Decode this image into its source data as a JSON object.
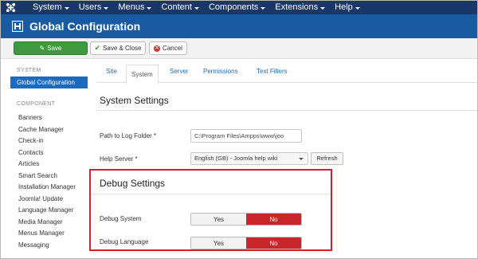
{
  "topnav": {
    "logo_icon": "joomla-logo-icon",
    "menus": [
      "System",
      "Users",
      "Menus",
      "Content",
      "Components",
      "Extensions",
      "Help"
    ]
  },
  "titlebar": {
    "icon": "gear-grid-icon",
    "title": "Global Configuration"
  },
  "toolbar": {
    "save_label": "Save",
    "save_close_label": "Save & Close",
    "cancel_label": "Cancel"
  },
  "sidebar": {
    "system_heading": "SYSTEM",
    "active_item": "Global Configuration",
    "component_heading": "COMPONENT",
    "items": [
      "Banners",
      "Cache Manager",
      "Check-in",
      "Contacts",
      "Articles",
      "Smart Search",
      "Installation Manager",
      "Joomla! Update",
      "Language Manager",
      "Media Manager",
      "Menus Manager",
      "Messaging"
    ]
  },
  "tabs": [
    "Site",
    "System",
    "Server",
    "Permissions",
    "Text Filters"
  ],
  "active_tab": "System",
  "system_settings": {
    "heading": "System Settings",
    "log_folder_label": "Path to Log Folder *",
    "log_folder_value": "C:\\Program Files\\Ampps\\www\\joo",
    "help_server_label": "Help Server *",
    "help_server_value": "English (GB) - Joomla help wiki",
    "refresh_label": "Refresh"
  },
  "debug_settings": {
    "heading": "Debug Settings",
    "debug_system_label": "Debug System",
    "debug_language_label": "Debug Language",
    "yes_label": "Yes",
    "no_label": "No",
    "debug_system_value": "No",
    "debug_language_value": "No"
  },
  "colors": {
    "topnav": "#1a3867",
    "titlebar": "#1a5aa1",
    "save_green": "#3f9a3f",
    "active_blue": "#1a6ac0",
    "no_red": "#c9262c",
    "highlight_border": "#d3202b"
  }
}
